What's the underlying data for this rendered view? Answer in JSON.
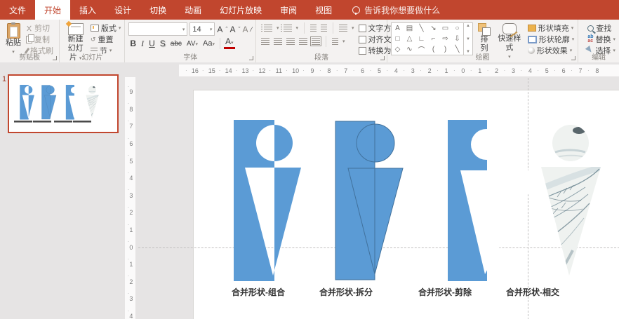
{
  "colors": {
    "accent_red": "#C1462E",
    "shape_blue": "#5B9BD5",
    "shape_outline_blue": "#41719C"
  },
  "titlebar": {
    "tabs": [
      {
        "label": "文件",
        "active": false
      },
      {
        "label": "开始",
        "active": true
      },
      {
        "label": "插入",
        "active": false
      },
      {
        "label": "设计",
        "active": false
      },
      {
        "label": "切换",
        "active": false
      },
      {
        "label": "动画",
        "active": false
      },
      {
        "label": "幻灯片放映",
        "active": false
      },
      {
        "label": "审阅",
        "active": false
      },
      {
        "label": "视图",
        "active": false
      }
    ],
    "tell_me": "告诉我你想要做什么"
  },
  "ribbon": {
    "clipboard": {
      "group_label": "剪贴板",
      "paste": "粘贴",
      "cut": "剪切",
      "copy": "复制",
      "format_painter": "格式刷"
    },
    "slides": {
      "group_label": "幻灯片",
      "new_slide_line1": "新建",
      "new_slide_line2": "幻灯片",
      "layout": "版式",
      "reset": "重置",
      "section": "节"
    },
    "font": {
      "group_label": "字体",
      "size_value": "14",
      "grow": "A",
      "shrink": "A",
      "clear": "A",
      "bold": "B",
      "italic": "I",
      "underline": "U",
      "shadow": "S",
      "strike": "abc",
      "spacing": "AV",
      "case": "Aa",
      "font_color": "A"
    },
    "paragraph": {
      "group_label": "段落",
      "text_direction": "文字方向",
      "align_text": "对齐文本",
      "smartart": "转换为 SmartArt"
    },
    "drawing": {
      "group_label": "绘图",
      "gallery": [
        "A",
        "▤",
        "╲",
        "↘",
        "▭",
        "○",
        "□",
        "△",
        "∟",
        "⌐",
        "⇨",
        "⇩",
        "◇",
        "∿",
        "⌒",
        "(",
        ")",
        "╲"
      ],
      "arrange": "排列",
      "quick_styles": "快速样式",
      "shape_fill": "形状填充",
      "shape_outline": "形状轮廓",
      "shape_effects": "形状效果"
    },
    "editing": {
      "group_label": "编辑",
      "find": "查找",
      "replace": "替换",
      "select": "选择"
    }
  },
  "slide_panel": {
    "slide_number": "1"
  },
  "rulers": {
    "horizontal": [
      "16",
      "15",
      "14",
      "13",
      "12",
      "11",
      "10",
      "9",
      "8",
      "7",
      "6",
      "5",
      "4",
      "3",
      "2",
      "1",
      "0",
      "1",
      "2",
      "3",
      "4",
      "5",
      "6",
      "7",
      "8"
    ],
    "vertical": [
      "9",
      "8",
      "7",
      "6",
      "5",
      "4",
      "3",
      "2",
      "1",
      "0",
      "1",
      "2",
      "3",
      "4"
    ]
  },
  "slide": {
    "labels": [
      "合并形状-组合",
      "合并形状-拆分",
      "合并形状-剪除",
      "合并形状-相交"
    ]
  }
}
